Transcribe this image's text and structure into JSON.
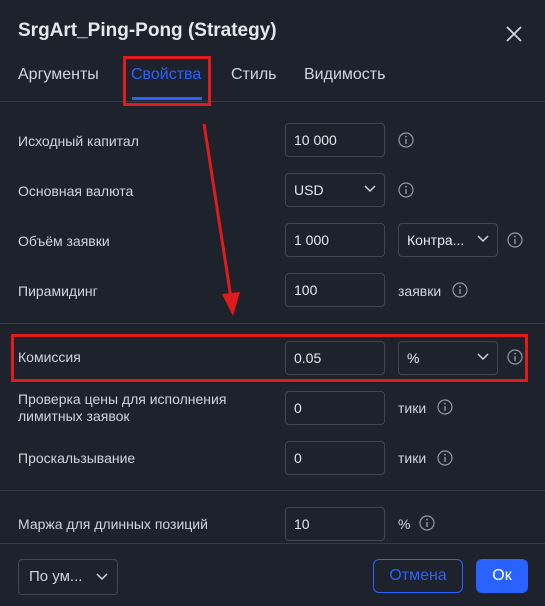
{
  "dialog": {
    "title": "SrgArt_Ping-Pong (Strategy)",
    "close_icon": "close-icon"
  },
  "tabs": [
    {
      "label": "Аргументы"
    },
    {
      "label": "Свойства",
      "active": true
    },
    {
      "label": "Стиль"
    },
    {
      "label": "Видимость"
    }
  ],
  "properties": {
    "initial_capital": {
      "label": "Исходный капитал",
      "value": "10 000"
    },
    "base_currency": {
      "label": "Основная валюта",
      "value": "USD"
    },
    "order_size": {
      "label": "Объём заявки",
      "value": "1 000",
      "unit": "Контра..."
    },
    "pyramiding": {
      "label": "Пирамидинг",
      "value": "100",
      "suffix": "заявки"
    },
    "commission": {
      "label": "Комиссия",
      "value": "0.05",
      "unit": "%"
    },
    "limit_price_check": {
      "label_line1": "Проверка цены для исполнения",
      "label_line2": "лимитных заявок",
      "value": "0",
      "suffix": "тики"
    },
    "slippage": {
      "label": "Проскальзывание",
      "value": "0",
      "suffix": "тики"
    },
    "long_margin": {
      "label": "Маржа для длинных позиций",
      "value": "10",
      "suffix": "%"
    }
  },
  "footer": {
    "defaults_label": "По ум...",
    "cancel_label": "Отмена",
    "ok_label": "Ок"
  },
  "colors": {
    "background": "#1e222d",
    "accent": "#2962ff",
    "annotation": "#e01b1b"
  }
}
